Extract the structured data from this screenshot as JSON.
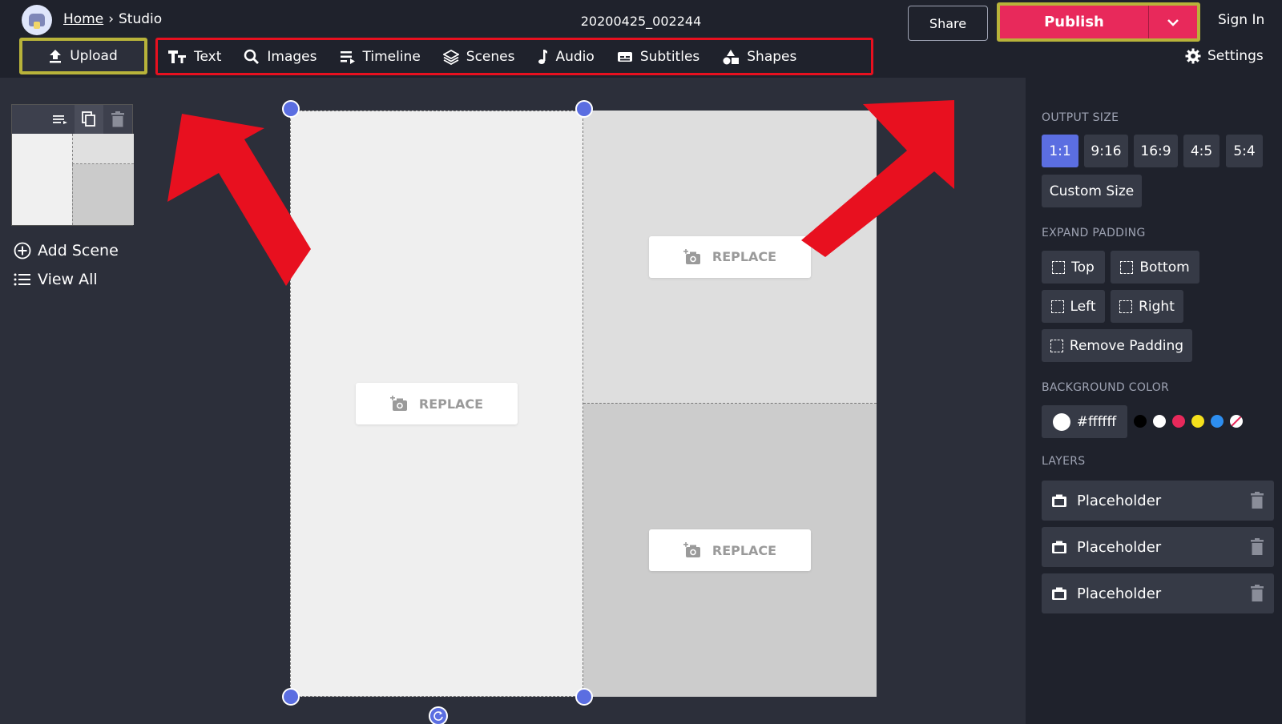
{
  "header": {
    "breadcrumb_home": "Home",
    "breadcrumb_sep": "›",
    "breadcrumb_current": "Studio",
    "doc_title": "20200425_002244",
    "share_label": "Share",
    "publish_label": "Publish",
    "sign_in_label": "Sign In",
    "settings_label": "Settings",
    "upload_label": "Upload"
  },
  "toolbar": {
    "items": [
      {
        "label": "Text",
        "icon": "text-icon"
      },
      {
        "label": "Images",
        "icon": "search-icon"
      },
      {
        "label": "Timeline",
        "icon": "timeline-icon"
      },
      {
        "label": "Scenes",
        "icon": "layers-icon"
      },
      {
        "label": "Audio",
        "icon": "music-note-icon"
      },
      {
        "label": "Subtitles",
        "icon": "subtitles-icon"
      },
      {
        "label": "Shapes",
        "icon": "shapes-icon"
      }
    ]
  },
  "left_panel": {
    "add_scene_label": "Add Scene",
    "view_all_label": "View All"
  },
  "canvas": {
    "replace_label": "REPLACE"
  },
  "right_panel": {
    "output_size_label": "OUTPUT SIZE",
    "output_sizes": [
      "1:1",
      "9:16",
      "16:9",
      "4:5",
      "5:4"
    ],
    "selected_output_size": "1:1",
    "custom_size_label": "Custom Size",
    "expand_padding_label": "EXPAND PADDING",
    "padding_top": "Top",
    "padding_bottom": "Bottom",
    "padding_left": "Left",
    "padding_right": "Right",
    "remove_padding": "Remove Padding",
    "background_color_label": "BACKGROUND COLOR",
    "background_color_value": "#ffffff",
    "palette": [
      "#000000",
      "#ffffff",
      "#e8295b",
      "#f5e01c",
      "#2d8ef0",
      "none"
    ],
    "layers_label": "LAYERS",
    "layers": [
      "Placeholder",
      "Placeholder",
      "Placeholder"
    ]
  },
  "colors": {
    "accent": "#5b6ee1",
    "publish": "#e8295b",
    "highlight_outline": "#b8b33a",
    "annotation_red": "#e8101f"
  }
}
